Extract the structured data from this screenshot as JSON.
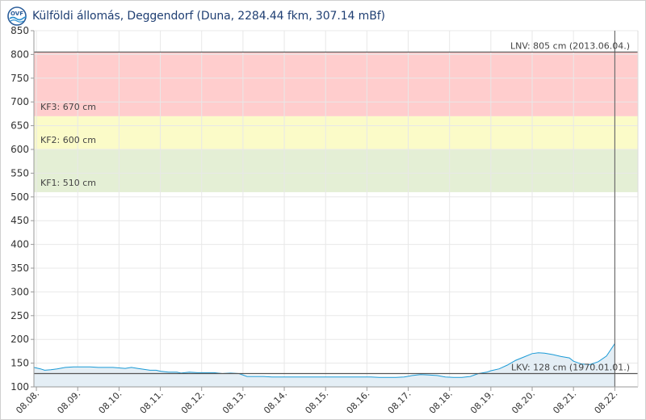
{
  "header": {
    "title": "Külföldi állomás, Deggendorf (Duna, 2284.44 fkm, 307.14 mBf)",
    "logo_icon": "ovf-wave-logo-icon"
  },
  "chart_data": {
    "type": "area",
    "title": "Külföldi állomás, Deggendorf (Duna, 2284.44 fkm, 307.14 mBf)",
    "xlabel": "",
    "ylabel": "",
    "ylim": [
      100,
      850
    ],
    "yticks": [
      "100",
      "150",
      "200",
      "250",
      "300",
      "350",
      "400",
      "450",
      "500",
      "550",
      "600",
      "650",
      "700",
      "750",
      "800",
      "850"
    ],
    "xticks": [
      "08.08.",
      "08.09.",
      "08.10.",
      "08.11.",
      "08.12.",
      "08.13.",
      "08.14.",
      "08.15.",
      "08.16.",
      "08.17.",
      "08.18.",
      "08.19.",
      "08.20.",
      "08.21.",
      "08.22."
    ],
    "grid": true,
    "colors": {
      "line": "#1a9ad6",
      "area": "#e4eef5",
      "kf1_zone": "#e4efd5",
      "kf2_zone": "#fbfbc8",
      "kf3_zone": "#ffcdcd",
      "threshold_line": "#555555",
      "gridline": "#e8e8e8"
    },
    "zones": [
      {
        "label": "KF1: 510 cm",
        "from": 510,
        "to": 600,
        "color_key": "kf1_zone"
      },
      {
        "label": "KF2: 600 cm",
        "from": 600,
        "to": 670,
        "color_key": "kf2_zone"
      },
      {
        "label": "KF3: 670 cm",
        "from": 670,
        "to": 805,
        "color_key": "kf3_zone"
      }
    ],
    "lines": [
      {
        "label": "LNV: 805 cm (2013.06.04.)",
        "value": 805
      },
      {
        "label": "LKV: 128 cm (1970.01.01.)",
        "value": 128
      }
    ],
    "current_marker_x": 14.0,
    "series": [
      {
        "x": [
          -0.06,
          0.1,
          0.2,
          0.35,
          0.5,
          0.7,
          0.9,
          1.1,
          1.3,
          1.5,
          1.7,
          1.85,
          2.0,
          2.15,
          2.3,
          2.45,
          2.6,
          2.75,
          2.9,
          3.0,
          3.2,
          3.4,
          3.5,
          3.7,
          3.9,
          4.1,
          4.3,
          4.5,
          4.7,
          4.9,
          5.1,
          5.3,
          5.5,
          5.7,
          5.9,
          6.1,
          6.3,
          6.5,
          6.7,
          6.9,
          7.1,
          7.3,
          7.5,
          7.7,
          7.9,
          8.1,
          8.3,
          8.5,
          8.7,
          8.9,
          9.1,
          9.3,
          9.5,
          9.7,
          9.9,
          10.1,
          10.3,
          10.5,
          10.7,
          10.9,
          11.0,
          11.2,
          11.4,
          11.6,
          11.8,
          12.0,
          12.15,
          12.3,
          12.5,
          12.7,
          12.9,
          13.0,
          13.2,
          13.4,
          13.6,
          13.8,
          14.0
        ],
        "values": [
          141,
          138,
          135,
          136,
          138,
          141,
          142,
          142,
          142,
          141,
          141,
          141,
          140,
          139,
          141,
          139,
          137,
          135,
          135,
          133,
          131,
          131,
          129,
          131,
          130,
          130,
          130,
          128,
          129,
          128,
          122,
          122,
          122,
          121,
          121,
          121,
          121,
          121,
          121,
          121,
          121,
          121,
          121,
          121,
          121,
          121,
          120,
          120,
          120,
          121,
          124,
          126,
          125,
          124,
          121,
          120,
          120,
          122,
          128,
          131,
          134,
          138,
          146,
          156,
          163,
          170,
          172,
          171,
          168,
          164,
          161,
          154,
          148,
          147,
          153,
          165,
          191
        ]
      }
    ]
  }
}
